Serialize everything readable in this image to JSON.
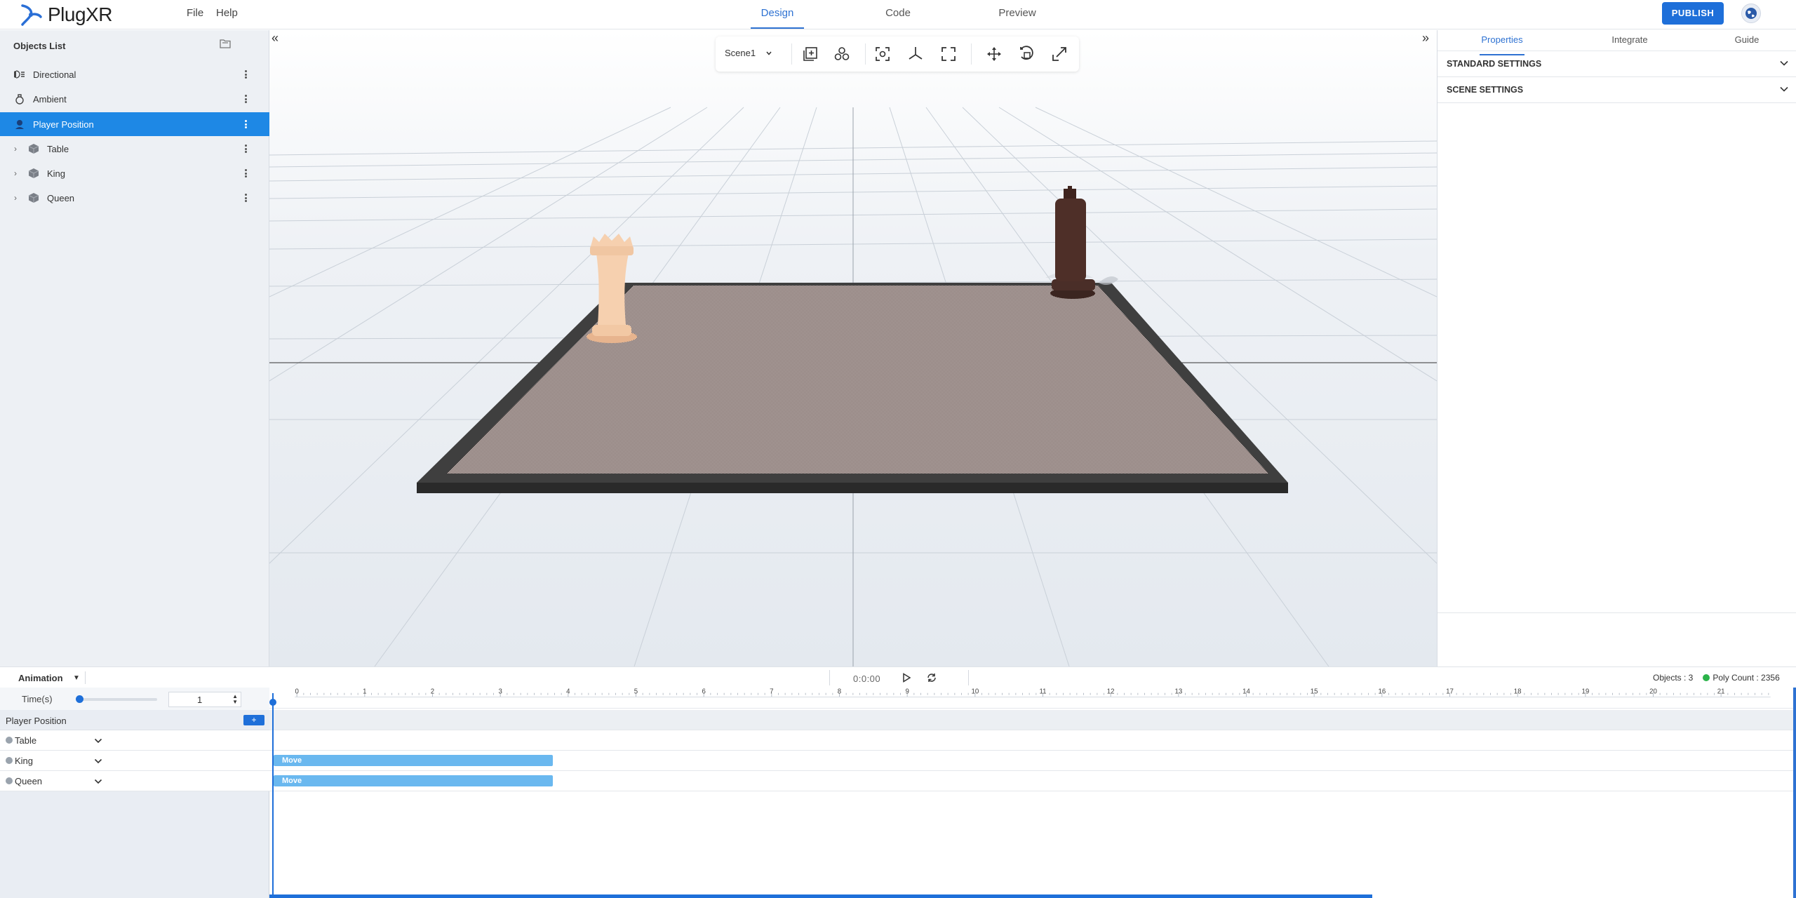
{
  "app": {
    "brand": "PlugXR",
    "menu": [
      "File",
      "Help"
    ],
    "tabs": [
      "Design",
      "Code",
      "Preview"
    ],
    "active_tab": "Design",
    "publish_label": "PUBLISH"
  },
  "objects_panel": {
    "title": "Objects List",
    "items": [
      {
        "label": "Directional",
        "icon": "directional-light-icon",
        "expandable": false
      },
      {
        "label": "Ambient",
        "icon": "ambient-light-icon",
        "expandable": false
      },
      {
        "label": "Player Position",
        "icon": "player-icon",
        "expandable": false,
        "selected": true
      },
      {
        "label": "Table",
        "icon": "cube-icon",
        "expandable": true
      },
      {
        "label": "King",
        "icon": "cube-icon",
        "expandable": true
      },
      {
        "label": "Queen",
        "icon": "cube-icon",
        "expandable": true
      }
    ]
  },
  "viewport": {
    "scene_select": "Scene1",
    "toolbar_icons": [
      "add-object-icon",
      "group-icon",
      "focus-icon",
      "axis-icon",
      "fullscreen-icon",
      "move-icon",
      "rotate-icon",
      "scale-icon"
    ]
  },
  "right_panel": {
    "tabs": [
      "Properties",
      "Integrate",
      "Guide"
    ],
    "active_tab": "Properties",
    "sections": [
      "STANDARD SETTINGS",
      "SCENE SETTINGS"
    ]
  },
  "animation": {
    "label": "Animation",
    "time_readout": "0:0:00",
    "objects_count": "Objects : 3",
    "poly_count": "Poly Count : 2356",
    "time_label": "Time(s)",
    "time_value": "1",
    "ruler_ticks": [
      "0",
      "1",
      "2",
      "3",
      "4",
      "5",
      "6",
      "7",
      "8",
      "9",
      "10",
      "11",
      "12",
      "13",
      "14",
      "15",
      "16",
      "17",
      "18",
      "19",
      "20",
      "21"
    ],
    "player_track": "Player Position",
    "add_label": "+",
    "tracks": [
      {
        "label": "Table",
        "clip": null
      },
      {
        "label": "King",
        "clip": "Move"
      },
      {
        "label": "Queen",
        "clip": "Move"
      }
    ]
  },
  "colors": {
    "accent": "#1e6fd9",
    "selected_row": "#1e88e5",
    "clip": "#6ab8ef",
    "status_ok": "#2bb34a"
  }
}
